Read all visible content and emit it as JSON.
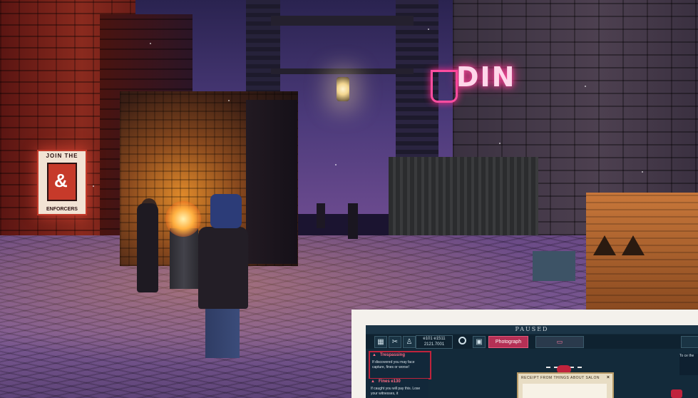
{
  "scene": {
    "poster": {
      "top_text": "JOIN THE",
      "emblem": "&",
      "bottom_text": "ENFORCERS"
    },
    "neon_sign": {
      "text": "DIN"
    }
  },
  "pause_menu": {
    "title": "PAUSED",
    "toolbar": {
      "icons": [
        "calendar-icon",
        "scissors-icon",
        "person-icon"
      ],
      "score_top": "e101 e1511",
      "score_bottom": "2121.7001",
      "photograph_label": "Photograph"
    },
    "cards": [
      {
        "title": "Trespassing",
        "body": "If discovered you may face capture, fines or worse!"
      },
      {
        "title": "Fines e130",
        "body": "If caught you will pay this. Lose your witnesses, it"
      }
    ],
    "evidence_note": {
      "heading": "RECEIPT FROM THINGS ABOUT SALON",
      "close": "×"
    },
    "right_panel_text": "To ce the"
  },
  "colors": {
    "alert_red": "#c0233c",
    "photo_button": "#b53055",
    "menu_bg": "#132a3a"
  }
}
